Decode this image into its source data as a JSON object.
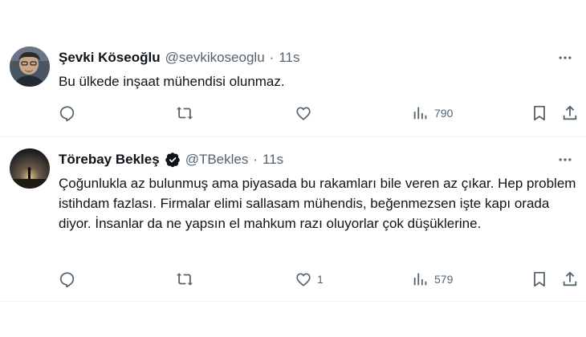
{
  "tweets": [
    {
      "name": "Şevki Köseoğlu",
      "handle": "@sevkikoseoglu",
      "separator": "·",
      "time": "11s",
      "text": "Bu ülkede inşaat mühendisi olunmaz.",
      "stats": {
        "replies": "",
        "retweets": "",
        "likes": "",
        "views": "790"
      },
      "verified": false
    },
    {
      "name": "Törebay Bekleş",
      "handle": "@TBekles",
      "separator": "·",
      "time": "11s",
      "text": "Çoğunlukla az bulunmuş ama piyasada bu rakamları bile veren az çıkar. Hep problem istihdam fazlası. Firmalar elimi sallasam mühendis, beğenmezsen işte kapı orada diyor. İnsanlar da ne yapsın el mahkum razı oluyorlar çok düşüklerine.",
      "stats": {
        "replies": "",
        "retweets": "",
        "likes": "1",
        "views": "579"
      },
      "verified": true
    }
  ],
  "colors": {
    "text": "#0f1419",
    "secondary": "#536471",
    "divider": "#eff3f4",
    "verified_badge": "#0f1419"
  },
  "icons": [
    "reply-icon",
    "retweet-icon",
    "like-icon",
    "views-icon",
    "bookmark-icon",
    "share-icon",
    "more-icon",
    "verified-icon"
  ]
}
